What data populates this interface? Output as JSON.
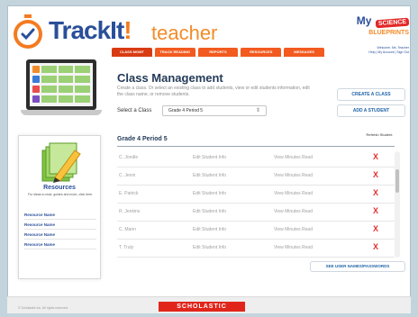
{
  "brand": {
    "name_part": "TrackIt",
    "exclaim": "!",
    "suffix": "teacher"
  },
  "my_logo": {
    "my": "My",
    "badge_top": "SCIENCE",
    "badge_bottom": "BLUEPRINTS"
  },
  "welcome": {
    "line1": "Welcome, Ms. Teacher",
    "line2": "Help | My Account | Sign Out"
  },
  "nav": [
    {
      "label": "CLASS MGMT",
      "active": true
    },
    {
      "label": "TRACK READING",
      "active": false
    },
    {
      "label": "REPORTS",
      "active": false
    },
    {
      "label": "RESOURCES",
      "active": false
    },
    {
      "label": "MESSAGES",
      "active": false
    }
  ],
  "main": {
    "title": "Class Management",
    "description": "Create a class. Or select an existing class to add students, view or edit students information, edit the class name, or remove students.",
    "select_label": "Select a Class",
    "select_value": "Grade 4 Period 5",
    "create_button": "CREATE A CLASS",
    "add_button": "ADD A STUDENT"
  },
  "table": {
    "title": "Grade 4 Period 5",
    "refresh_header": "Refresh Student",
    "rows": [
      {
        "name": "C. Jondle",
        "edit": "Edit Student Info",
        "view": "View Minutes Read",
        "remove": "X"
      },
      {
        "name": "C. Jenni",
        "edit": "Edit Student Info",
        "view": "View Minutes Read",
        "remove": "X"
      },
      {
        "name": "E. Patrick",
        "edit": "Edit Student Info",
        "view": "View Minutes Read",
        "remove": "X"
      },
      {
        "name": "R. Jenkins",
        "edit": "Edit Student Info",
        "view": "View Minutes Read",
        "remove": "X"
      },
      {
        "name": "C. Mann",
        "edit": "Edit Student Info",
        "view": "View Minutes Read",
        "remove": "X"
      },
      {
        "name": "T. Truly",
        "edit": "Edit Student Info",
        "view": "View Minutes Read",
        "remove": "X"
      }
    ],
    "see_names_button": "SEE USER NAMES/PASSWORDS"
  },
  "resources": {
    "title": "Resources",
    "description": "For ideas to read, guides and more, click here.",
    "items": [
      "Resource Name",
      "Resource Name",
      "Resource Name",
      "Resource Name"
    ]
  },
  "footer": {
    "logo": "SCHOLASTIC",
    "copyright": "© Scholastic Inc. All rights reserved."
  },
  "colors": {
    "accent_orange": "#f25a1f",
    "brand_blue": "#2a4f9a",
    "remove_red": "#e62e2e"
  }
}
